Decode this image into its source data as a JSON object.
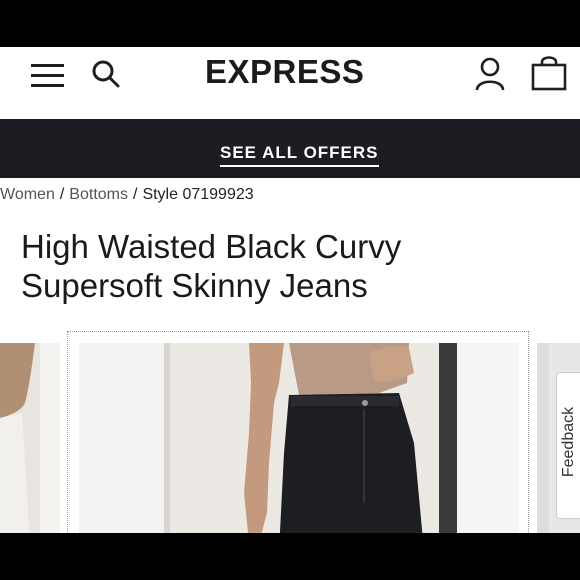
{
  "header": {
    "brand": "EXPRESS"
  },
  "promo": {
    "label": "SEE ALL OFFERS"
  },
  "breadcrumb": {
    "women": "Women",
    "bottoms": "Bottoms",
    "style": "Style 07199923",
    "separator": "/"
  },
  "product": {
    "title": "High Waisted Black Curvy Supersoft Skinny Jeans"
  },
  "feedback": {
    "label": "Feedback"
  },
  "colors": {
    "promo_bar": "#1c1d22",
    "text": "#1a1a1a"
  }
}
